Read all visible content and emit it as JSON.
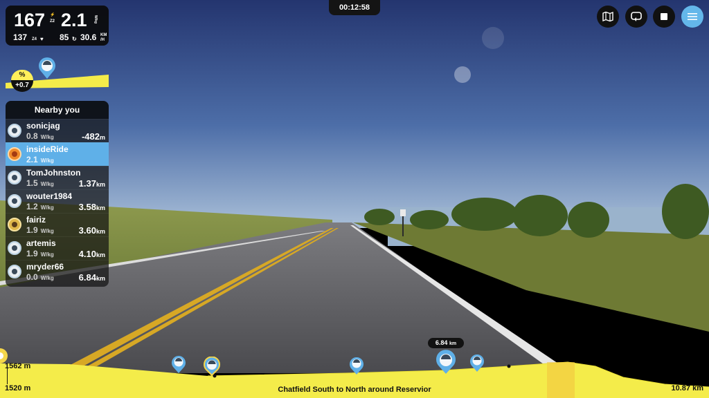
{
  "ride": {
    "timer": "00:12:58",
    "course_name": "Chatfield South to North around Reservior"
  },
  "metrics": {
    "power": "167",
    "power_zone_icon": "bolt-icon",
    "power_zone": "Z2",
    "wkg": "2.1",
    "wkg_unit": "W/kg",
    "heart_rate": "137",
    "hr_zone": "Z4",
    "hr_icon": "heart-icon",
    "cadence": "85",
    "cadence_icon": "cadence-icon",
    "speed": "30.6",
    "speed_unit_top": "KM",
    "speed_unit_bottom": "/H"
  },
  "grade": {
    "symbol": "%",
    "value": "+0.7"
  },
  "nearby": {
    "title": "Nearby you",
    "riders": [
      {
        "name": "sonicjag",
        "wkg": "0.8",
        "unit": "W/kg",
        "distance": "-482",
        "distance_unit": "m",
        "selected": false
      },
      {
        "name": "insideRide",
        "wkg": "2.1",
        "unit": "W/kg",
        "distance": "",
        "distance_unit": "",
        "selected": true
      },
      {
        "name": "TomJohnston",
        "wkg": "1.5",
        "unit": "W/kg",
        "distance": "1.37",
        "distance_unit": "km",
        "selected": false
      },
      {
        "name": "wouter1984",
        "wkg": "1.2",
        "unit": "W/kg",
        "distance": "3.58",
        "distance_unit": "km",
        "selected": false
      },
      {
        "name": "fairiz",
        "wkg": "1.9",
        "unit": "W/kg",
        "distance": "3.60",
        "distance_unit": "km",
        "selected": false
      },
      {
        "name": "artemis",
        "wkg": "1.9",
        "unit": "W/kg",
        "distance": "4.10",
        "distance_unit": "km",
        "selected": false
      },
      {
        "name": "mryder66",
        "wkg": "0.0",
        "unit": "W/kg",
        "distance": "6.84",
        "distance_unit": "km",
        "selected": false
      }
    ]
  },
  "toolbar": {
    "map_icon": "map-icon",
    "loop_icon": "loop-icon",
    "stop_icon": "stop-icon",
    "menu_icon": "menu-icon"
  },
  "elevation": {
    "max": "1562 m",
    "min": "1520 m",
    "total_distance": "10.87 km",
    "marker_distance": "6.84",
    "marker_unit": "km"
  },
  "colors": {
    "accent_yellow": "#fff05a",
    "accent_blue": "#64b7ea",
    "panel_dark": "#111111"
  }
}
